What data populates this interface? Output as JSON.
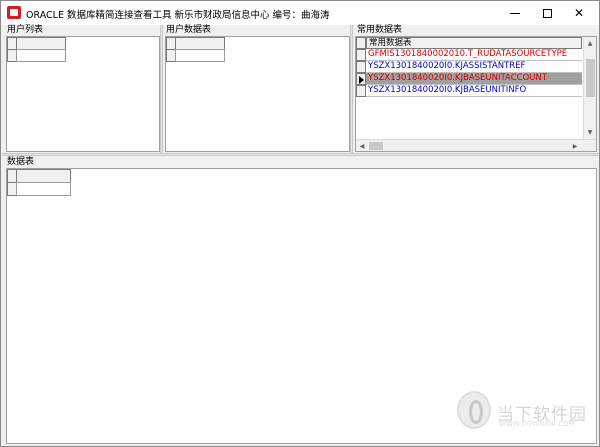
{
  "window": {
    "title": "ORACLE 数据库精简连接查看工具 新乐市财政局信息中心  编号：曲海涛",
    "icon": "app-icon",
    "controls": [
      "minimize-icon",
      "maximize-icon",
      "close-icon"
    ]
  },
  "panels": {
    "user_list": {
      "label": "用户列表"
    },
    "user_tables": {
      "label": "用户数据表"
    },
    "common_tables": {
      "label": "常用数据表",
      "column_header": "常用数据表",
      "rows": [
        {
          "text": "GFMIS1301840002010.T_RUDATASOURCETYPE",
          "color": "#d40000",
          "selected": false
        },
        {
          "text": "YSZX1301840020I0.KJASSISTANTREF",
          "color": "#0000c0",
          "selected": false
        },
        {
          "text": "YSZX1301840020I0.KJBASEUNITACCOUNT",
          "color": "#d40000",
          "selected": true
        },
        {
          "text": "YSZX1301840020I0.KJBASEUNITINFO",
          "color": "#0000c0",
          "selected": false
        }
      ]
    },
    "data_table": {
      "label": "数据表"
    }
  },
  "watermark": {
    "brand": "当下软件园",
    "url": "WWW.DOWNXIA.COM"
  }
}
